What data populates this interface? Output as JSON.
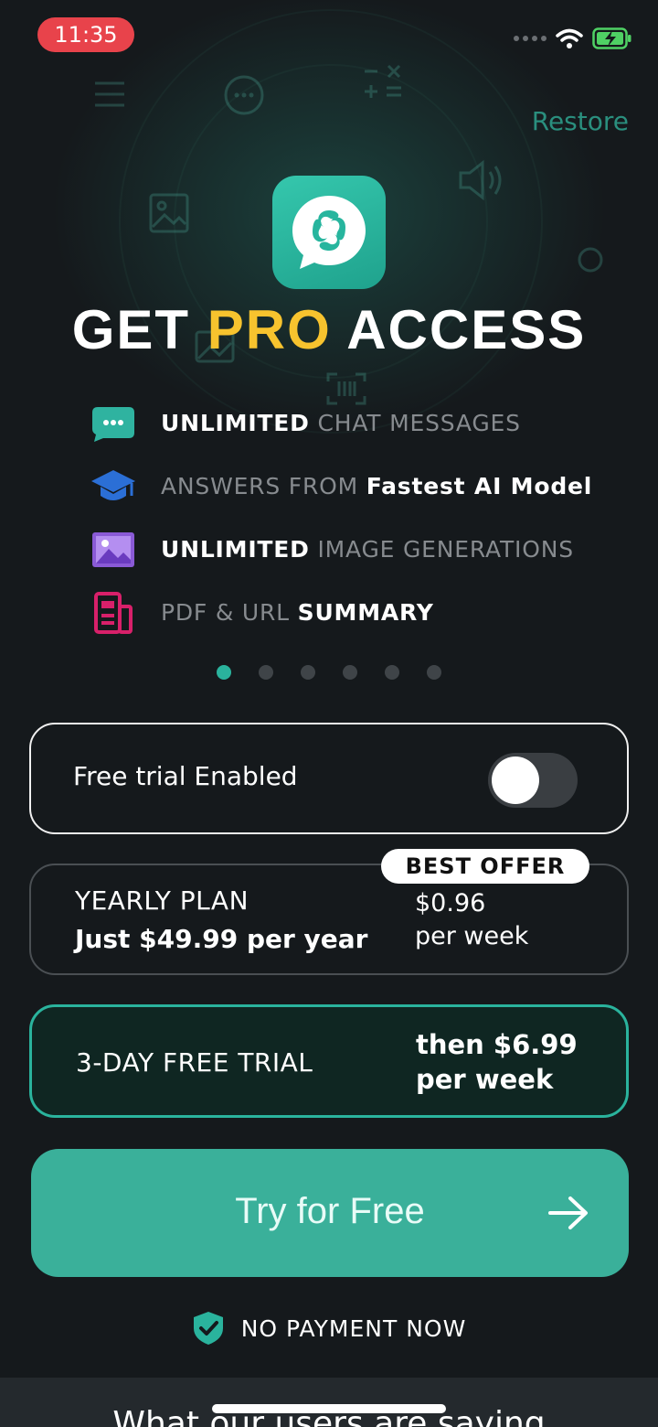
{
  "status_bar": {
    "time": "11:35"
  },
  "header": {
    "restore_label": "Restore"
  },
  "headline": {
    "part1": "GET ",
    "part2": "PRO",
    "part3": " ACCESS"
  },
  "features": [
    {
      "icon": "chat-bubble-icon",
      "bold": "UNLIMITED",
      "dim": " CHAT MESSAGES"
    },
    {
      "icon": "graduation-cap-icon",
      "dim": "ANSWERS FROM ",
      "bold": "Fastest AI Model"
    },
    {
      "icon": "image-icon",
      "bold": "UNLIMITED",
      "dim": " IMAGE GENERATIONS"
    },
    {
      "icon": "document-icon",
      "dim": "PDF & URL ",
      "bold": "SUMMARY"
    }
  ],
  "pager": {
    "count": 6,
    "active": 1
  },
  "free_trial_toggle": {
    "label": "Free trial Enabled",
    "enabled": false
  },
  "yearly_plan": {
    "badge": "BEST OFFER",
    "name": "YEARLY PLAN",
    "price": "Just $49.99 per year",
    "per_week_price": "$0.96",
    "per_week_label": "per week"
  },
  "trial_plan": {
    "name": "3-DAY FREE TRIAL",
    "then_line1": "then $6.99",
    "then_line2": "per week"
  },
  "cta": {
    "label": "Try for Free"
  },
  "footer_note": {
    "label": "NO PAYMENT NOW"
  },
  "bottom_sheet": {
    "title": "What our users are saying"
  },
  "colors": {
    "accent": "#2ab39d",
    "highlight": "#f7c32e",
    "status_pill": "#e8434b",
    "background": "#15191c"
  }
}
